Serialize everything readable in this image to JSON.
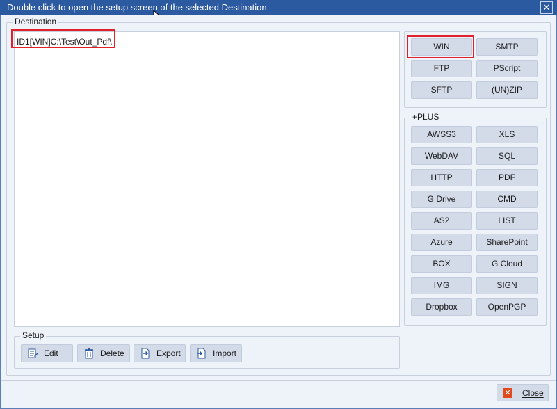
{
  "window": {
    "title": "Double click to open the setup screen of the selected Destination",
    "close_glyph": "✕"
  },
  "destination": {
    "group_label": "Destination",
    "entries": [
      "ID1[WIN]C:\\Test\\Out_Pdf\\"
    ]
  },
  "protocols": {
    "buttons": [
      "WIN",
      "SMTP",
      "FTP",
      "PScript",
      "SFTP",
      "(UN)ZIP"
    ]
  },
  "plus": {
    "group_label": "+PLUS",
    "buttons": [
      "AWSS3",
      "XLS",
      "WebDAV",
      "SQL",
      "HTTP",
      "PDF",
      "G Drive",
      "CMD",
      "AS2",
      "LIST",
      "Azure",
      "SharePoint",
      "BOX",
      "G Cloud",
      "IMG",
      "SIGN",
      "Dropbox",
      "OpenPGP"
    ]
  },
  "setup": {
    "group_label": "Setup",
    "edit_label": "Edit",
    "delete_label": "Delete",
    "export_label": "Export",
    "import_label": "Import"
  },
  "footer": {
    "close_label": "Close"
  },
  "colors": {
    "accent": "#2c5aa0",
    "highlight": "#e0202a",
    "button_bg": "#d3dbe9"
  }
}
